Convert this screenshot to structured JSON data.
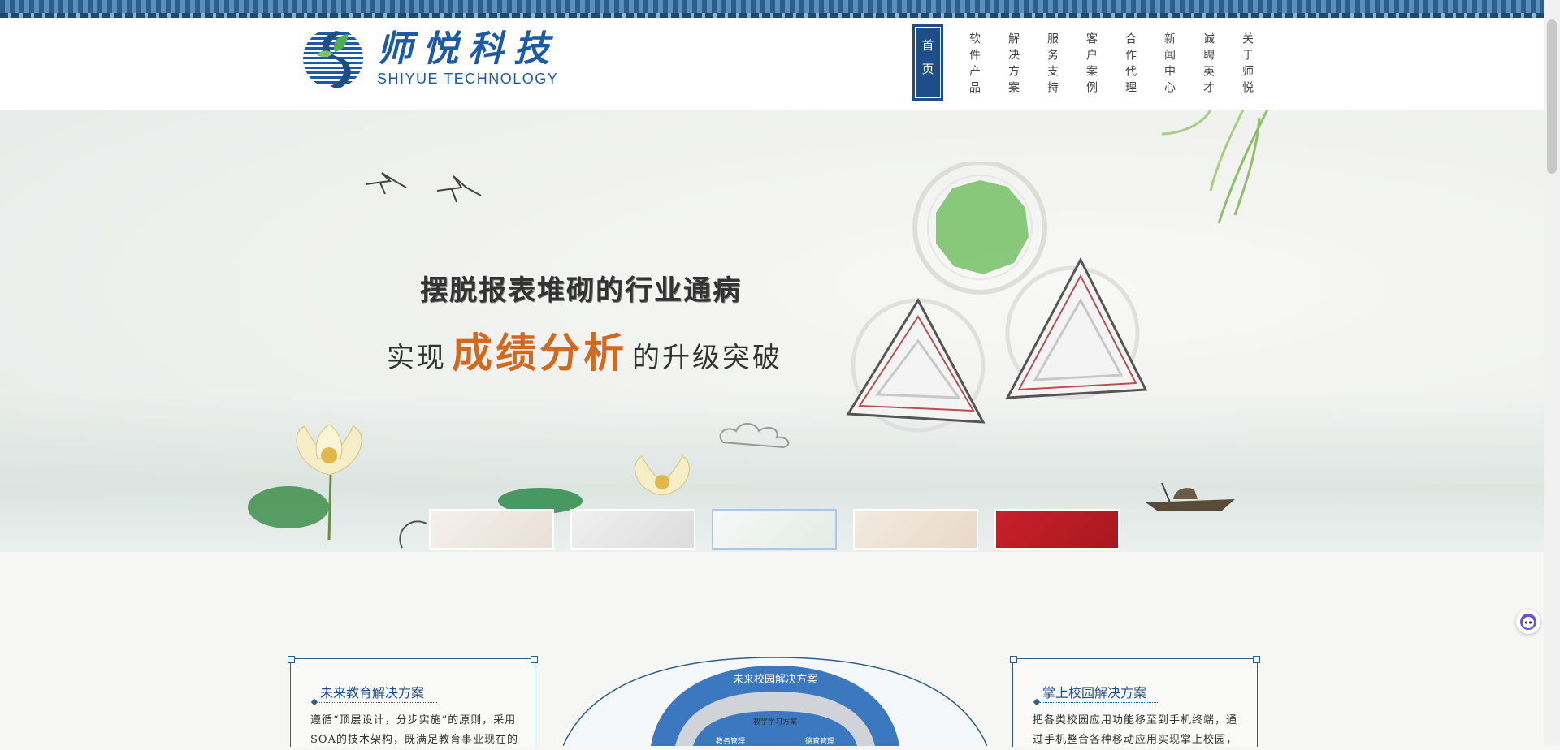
{
  "brand": {
    "name_cn": "师悦科技",
    "name_en": "SHIYUE TECHNOLOGY"
  },
  "nav": {
    "home": "首页",
    "items": [
      "软件产品",
      "解决方案",
      "服务支持",
      "客户案例",
      "合作代理",
      "新闻中心",
      "诚聘英才",
      "关于师悦"
    ]
  },
  "banner": {
    "headline": "摆脱报表堆砌的行业通病",
    "sub_prefix": "实现",
    "sub_highlight": "成绩分析",
    "sub_suffix": "的升级突破"
  },
  "panels": {
    "left": {
      "title": "未来教育解决方案",
      "text": "遵循“顶层设计，分步实施”的原则，采用SOA的技术架构，既满足教育事业现在的"
    },
    "center": {
      "title": "未来校园解决方案",
      "labels": [
        "教学学习方案",
        "教务管理",
        "德育管理"
      ]
    },
    "right": {
      "title": "掌上校园解决方案",
      "text": "把各类校园应用功能移至到手机终端，通过手机整合各种移动应用实现掌上校园，"
    }
  },
  "colors": {
    "brand_blue": "#1d5aa6",
    "nav_active": "#1d4e88",
    "highlight_orange": "#d2691e"
  }
}
